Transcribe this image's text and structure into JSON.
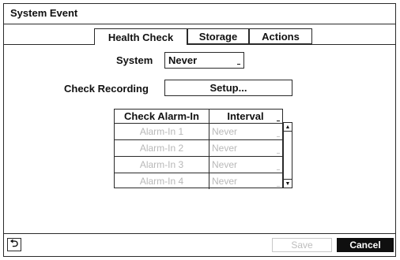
{
  "dialog": {
    "title": "System Event"
  },
  "tabs": [
    {
      "label": "Health Check"
    },
    {
      "label": "Storage"
    },
    {
      "label": "Actions"
    }
  ],
  "form": {
    "system_label": "System",
    "system_value": "Never",
    "check_recording_label": "Check Recording",
    "setup_button": "Setup..."
  },
  "grid": {
    "headers": {
      "alarm": "Check Alarm-In",
      "interval": "Interval"
    },
    "rows": [
      {
        "alarm": "Alarm-In 1",
        "interval": "Never"
      },
      {
        "alarm": "Alarm-In 2",
        "interval": "Never"
      },
      {
        "alarm": "Alarm-In 3",
        "interval": "Never"
      },
      {
        "alarm": "Alarm-In 4",
        "interval": "Never"
      }
    ]
  },
  "icons": {
    "back": "back-arrow-icon",
    "scroll_up": "arrow-up-icon",
    "scroll_down": "arrow-down-icon"
  },
  "footer": {
    "save": "Save",
    "cancel": "Cancel"
  }
}
